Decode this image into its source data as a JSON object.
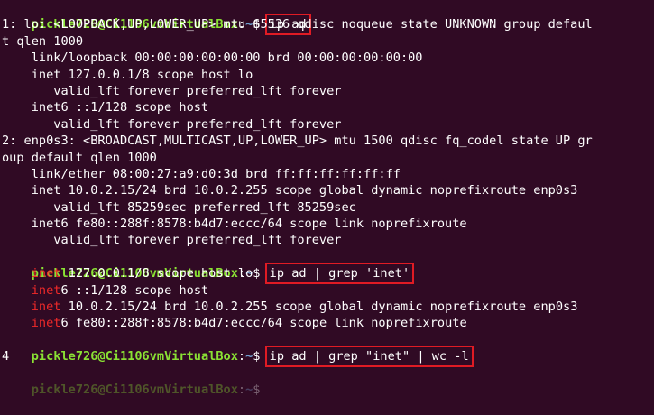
{
  "prompt": {
    "user_host": "pickle726@Ci1106vmVirtualBox",
    "sep": ":",
    "path": "~",
    "symbol": "$ "
  },
  "session": [
    {
      "command": "ip ad",
      "output": [
        "1: lo: <LOOPBACK,UP,LOWER_UP> mtu 65536 qdisc noqueue state UNKNOWN group defaul",
        "t qlen 1000",
        "    link/loopback 00:00:00:00:00:00 brd 00:00:00:00:00:00",
        "    inet 127.0.0.1/8 scope host lo",
        "       valid_lft forever preferred_lft forever",
        "    inet6 ::1/128 scope host",
        "       valid_lft forever preferred_lft forever",
        "2: enp0s3: <BROADCAST,MULTICAST,UP,LOWER_UP> mtu 1500 qdisc fq_codel state UP gr",
        "oup default qlen 1000",
        "    link/ether 08:00:27:a9:d0:3d brd ff:ff:ff:ff:ff:ff",
        "    inet 10.0.2.15/24 brd 10.0.2.255 scope global dynamic noprefixroute enp0s3",
        "       valid_lft 85259sec preferred_lft 85259sec",
        "    inet6 fe80::288f:8578:b4d7:eccc/64 scope link noprefixroute",
        "       valid_lft forever preferred_lft forever"
      ]
    },
    {
      "command": "ip ad | grep 'inet'",
      "grep_output": [
        {
          "indent": "    ",
          "match": "inet",
          "rest": " 127.0.0.1/8 scope host lo"
        },
        {
          "indent": "    ",
          "match": "inet",
          "rest": "6 ::1/128 scope host"
        },
        {
          "indent": "    ",
          "match": "inet",
          "rest": " 10.0.2.15/24 brd 10.0.2.255 scope global dynamic noprefixroute enp0s3"
        },
        {
          "indent": "    ",
          "match": "inet",
          "rest": "6 fe80::288f:8578:b4d7:eccc/64 scope link noprefixroute"
        }
      ]
    },
    {
      "command": "ip ad | grep \"inet\" | wc -l",
      "output": [
        "4"
      ]
    }
  ],
  "colors": {
    "background": "#300a24",
    "prompt_user": "#8ae234",
    "prompt_path": "#729fcf",
    "grep_match": "#ef2929",
    "highlight_box": "#e01b24"
  }
}
